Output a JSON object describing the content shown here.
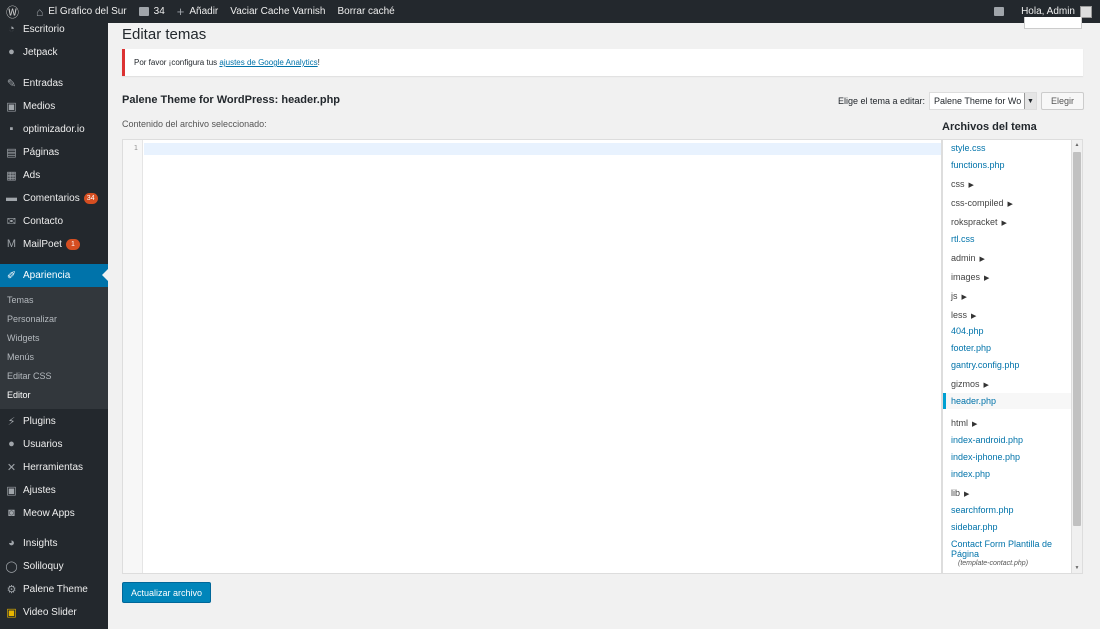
{
  "admin_bar": {
    "site_name": "El Grafico del Sur",
    "comments_count": "34",
    "new_label": "Añadir",
    "varnish_label": "Vaciar Cache Varnish",
    "cache_label": "Borrar caché",
    "greeting": "Hola, Admin"
  },
  "sidebar": {
    "escritorio": "Escritorio",
    "jetpack": "Jetpack",
    "entradas": "Entradas",
    "medios": "Medios",
    "optimizador": "optimizador.io",
    "paginas": "Páginas",
    "ads": "Ads",
    "comentarios": "Comentarios",
    "comentarios_badge": "34",
    "contacto": "Contacto",
    "mailpoet": "MailPoet",
    "mailpoet_badge": "1",
    "apariencia": "Apariencia",
    "submenu": {
      "temas": "Temas",
      "personalizar": "Personalizar",
      "widgets": "Widgets",
      "menus": "Menús",
      "editar_css": "Editar CSS",
      "editor": "Editor"
    },
    "plugins": "Plugins",
    "usuarios": "Usuarios",
    "herramientas": "Herramientas",
    "ajustes": "Ajustes",
    "meow": "Meow Apps",
    "insights": "Insights",
    "soliloquy": "Soliloquy",
    "palene": "Palene Theme",
    "video_slider": "Video Slider"
  },
  "main": {
    "page_title": "Editar temas",
    "notice_prefix": "Por favor ¡configura tus",
    "notice_link": "ajustes de Google Analytics",
    "notice_suffix": "!",
    "file_title": "Palene Theme for WordPress: header.php",
    "select_label": "Elige el tema a editar:",
    "select_value": "Palene Theme for Wo",
    "select_button": "Elegir",
    "content_label": "Contenido del archivo seleccionado:",
    "line_number": "1",
    "files_heading": "Archivos del tema",
    "files": {
      "f1": "style.css",
      "f2": "functions.php",
      "f3": "css",
      "f4": "css-compiled",
      "f5": "rokspracket",
      "f6": "rtl.css",
      "f7": "admin",
      "f8": "images",
      "f9": "js",
      "f10": "less",
      "f11": "404.php",
      "f12": "footer.php",
      "f13": "gantry.config.php",
      "f14": "gizmos",
      "f15": "header.php",
      "f16": "html",
      "f17": "index-android.php",
      "f18": "index-iphone.php",
      "f19": "index.php",
      "f20": "lib",
      "f21": "searchform.php",
      "f22": "sidebar.php",
      "f23a": "Contact Form Plantilla de",
      "f23b": "Página",
      "f23c": "(template-contact.php)"
    },
    "update_button": "Actualizar archivo"
  },
  "colors": {
    "accent": "#0073aa",
    "primary_button": "#0085ba",
    "admin_dark": "#23282d",
    "notice_error": "#dc3232",
    "badge": "#d54e21"
  }
}
